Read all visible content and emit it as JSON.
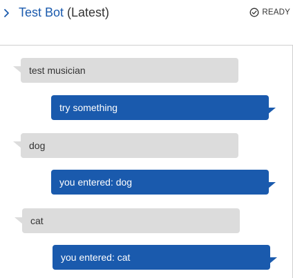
{
  "header": {
    "bot_name": "Test Bot",
    "version": "(Latest)",
    "status": "READY",
    "expand_icon": "chevron-right-icon",
    "status_icon": "check-circle-icon"
  },
  "colors": {
    "accent": "#1a5aad",
    "user_bubble": "#dcdcdc",
    "border": "#cfcfcf"
  },
  "messages": [
    {
      "from": "user",
      "text": "test musician"
    },
    {
      "from": "bot",
      "text": "try something"
    },
    {
      "from": "user",
      "text": "dog"
    },
    {
      "from": "bot",
      "text": "you entered: dog"
    },
    {
      "from": "user",
      "text": "cat"
    },
    {
      "from": "bot",
      "text": "you entered: cat"
    }
  ]
}
